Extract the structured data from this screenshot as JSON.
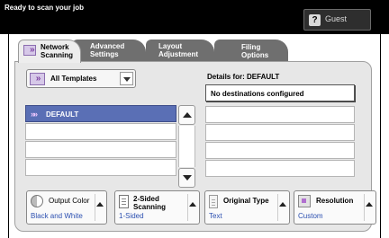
{
  "header": {
    "status": "Ready to scan your job",
    "user_icon": "question-mark-icon",
    "user_label": "Guest"
  },
  "tabs": [
    {
      "label_line1": "Network",
      "label_line2": "Scanning",
      "active": true
    },
    {
      "label_line1": "Advanced",
      "label_line2": "Settings",
      "active": false
    },
    {
      "label_line1": "Layout",
      "label_line2": "Adjustment",
      "active": false
    },
    {
      "label_line1": "Filing Options",
      "label_line2": "",
      "active": false
    }
  ],
  "templates": {
    "dropdown_label": "All Templates",
    "items": [
      "DEFAULT"
    ]
  },
  "details": {
    "label": "Details for: DEFAULT",
    "message": "No destinations configured"
  },
  "options": {
    "output_color": {
      "title": "Output Color",
      "value": "Black and White"
    },
    "two_sided": {
      "title_line1": "2-Sided",
      "title_line2": "Scanning",
      "value": "1-Sided"
    },
    "original_type": {
      "title": "Original Type",
      "value": "Text"
    },
    "resolution": {
      "title": "Resolution",
      "value": "Custom"
    }
  },
  "colors": {
    "header_bg": "#000000",
    "tab_active": "#ededed",
    "tab_inactive": "#6f6f6f",
    "selected_row": "#5a6fb5",
    "value_text": "#2b4fb0"
  }
}
